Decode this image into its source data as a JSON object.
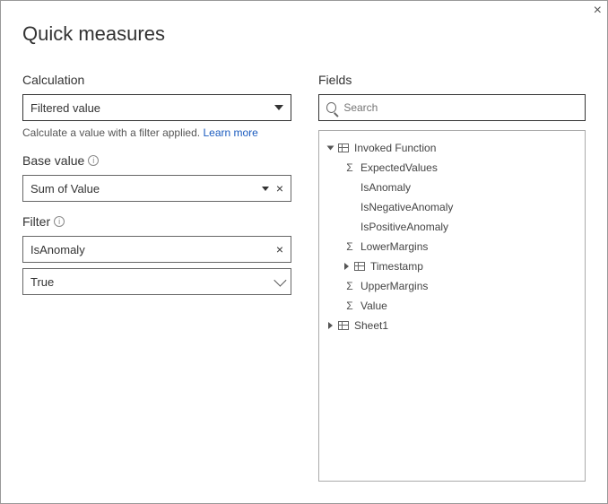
{
  "dialog": {
    "title": "Quick measures"
  },
  "left": {
    "calculation": {
      "label": "Calculation",
      "selected": "Filtered value",
      "helper": "Calculate a value with a filter applied.",
      "learn_more": "Learn more"
    },
    "base_value": {
      "label": "Base value",
      "selected": "Sum of Value"
    },
    "filter": {
      "label": "Filter",
      "field": "IsAnomaly",
      "value": "True"
    }
  },
  "right": {
    "label": "Fields",
    "search_placeholder": "Search",
    "tree": {
      "table1": "Invoked Function",
      "f_expected": "ExpectedValues",
      "f_isanomaly": "IsAnomaly",
      "f_isneg": "IsNegativeAnomaly",
      "f_ispos": "IsPositiveAnomaly",
      "f_lower": "LowerMargins",
      "f_timestamp": "Timestamp",
      "f_upper": "UpperMargins",
      "f_value": "Value",
      "table2": "Sheet1"
    }
  }
}
